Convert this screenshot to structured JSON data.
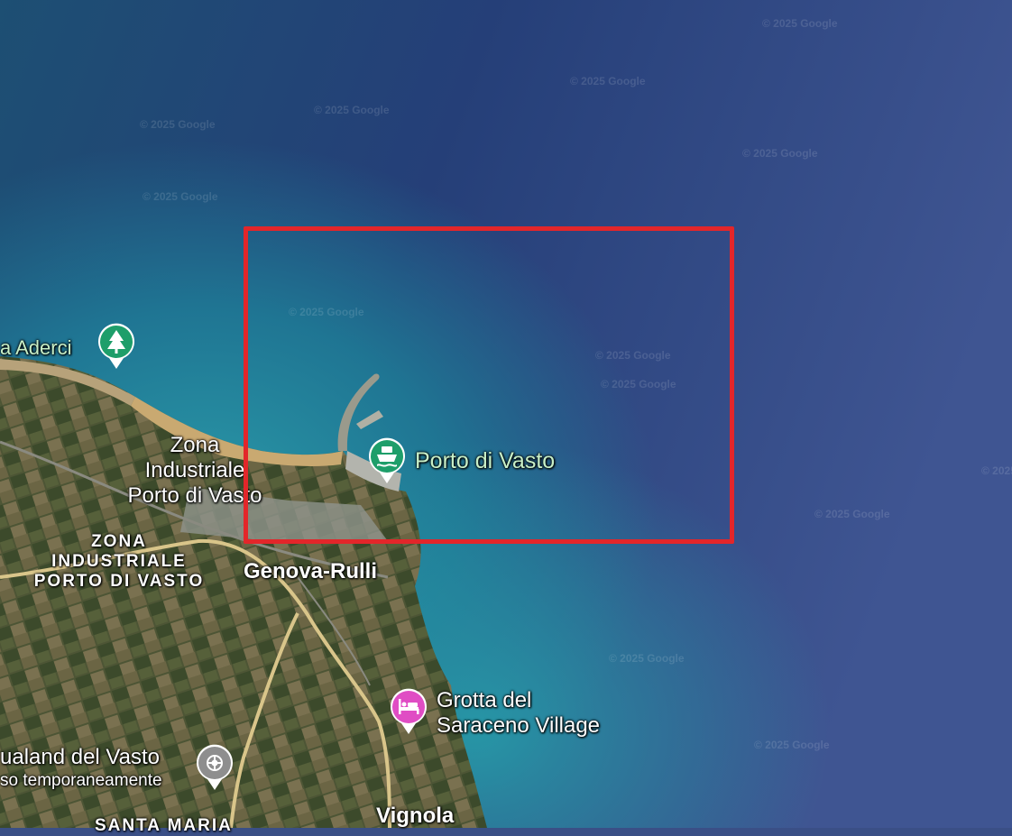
{
  "map": {
    "watermark": "© 2025 Google",
    "highlight_color": "#e3262a",
    "labels": {
      "aderci": "a Aderci",
      "zona_industriale": [
        "Zona",
        "Industriale",
        "Porto di Vasto"
      ],
      "zona_caps": [
        "ZONA",
        "INDUSTRIALE",
        "PORTO DI VASTO"
      ],
      "porto": "Porto di Vasto",
      "genova_rulli": "Genova-Rulli",
      "grotta": [
        "Grotta del",
        "Saraceno Village"
      ],
      "aqualand": "ualand del Vasto",
      "aqualand_status": "so temporaneamente",
      "santa_maria": "SANTA MARIA",
      "vignola": "Vignola"
    },
    "markers": [
      {
        "name": "park-marker",
        "icon": "tree-icon",
        "color": "#1e9e6a"
      },
      {
        "name": "port-marker",
        "icon": "ferry-icon",
        "color": "#1e9e6a"
      },
      {
        "name": "hotel-marker",
        "icon": "bed-icon",
        "color": "#e04dc4"
      },
      {
        "name": "attraction-marker",
        "icon": "attraction-icon",
        "color": "#8e8e8e"
      }
    ]
  }
}
